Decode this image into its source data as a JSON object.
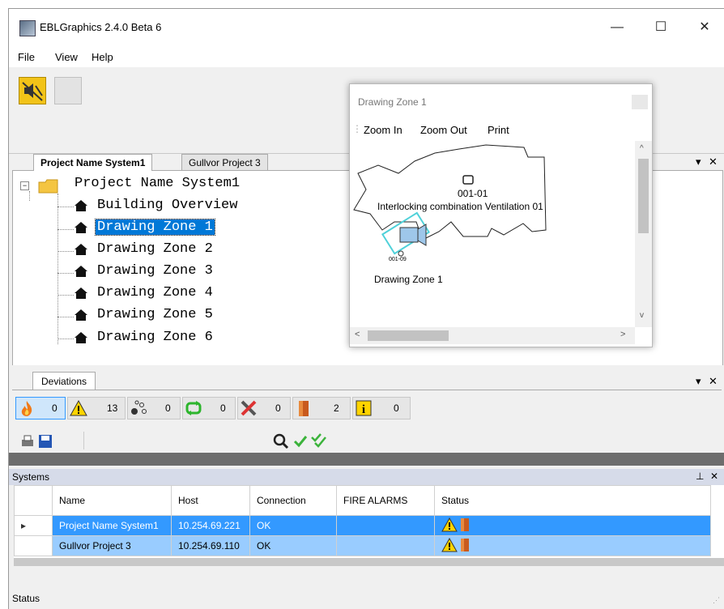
{
  "window": {
    "title": "EBLGraphics 2.4.0 Beta 6",
    "minimize": "—",
    "maximize": "☐",
    "close": "✕"
  },
  "menu": [
    "File",
    "View",
    "Help"
  ],
  "tabs": [
    "Project Name System1",
    "Gullvor Project 3"
  ],
  "tree": {
    "root": "Project Name System1",
    "items": [
      "Building Overview",
      "Drawing Zone 1",
      "Drawing Zone 2",
      "Drawing Zone 3",
      "Drawing Zone 4",
      "Drawing Zone 5",
      "Drawing Zone 6"
    ],
    "selected": "Drawing Zone 1"
  },
  "popup": {
    "title": "Drawing Zone 1",
    "toolbar": [
      "Zoom In",
      "Zoom Out",
      "Print"
    ],
    "device1_id": "001-01",
    "device1_label": "Interlocking combination Ventilation 01",
    "device2_id": "001-09",
    "zone_label": "Drawing Zone 1"
  },
  "deviations": {
    "tab": "Deviations",
    "counters": [
      {
        "icon": "fire-icon",
        "count": "0"
      },
      {
        "icon": "warning-icon",
        "count": "13"
      },
      {
        "icon": "network-icon",
        "count": "0"
      },
      {
        "icon": "cycle-icon",
        "count": "0"
      },
      {
        "icon": "tools-icon",
        "count": "0"
      },
      {
        "icon": "door-icon",
        "count": "2"
      },
      {
        "icon": "info-icon",
        "count": "0"
      }
    ]
  },
  "systems": {
    "title": "Systems",
    "columns": [
      "Name",
      "Host",
      "Connection",
      "FIRE ALARMS",
      "Status"
    ],
    "rows": [
      {
        "name": "Project Name System1",
        "host": "10.254.69.221",
        "connection": "OK",
        "fire_alarms": "",
        "status": "warning-icon door-icon"
      },
      {
        "name": "Gullvor Project 3",
        "host": "10.254.69.110",
        "connection": "OK",
        "fire_alarms": "",
        "status": "warning-icon door-icon"
      }
    ]
  },
  "statusbar": "Status",
  "colors": {
    "accent": "#0078d7",
    "selected_row": "#3399ff",
    "secondary_row": "#99ccff",
    "warning": "#ffd400"
  }
}
